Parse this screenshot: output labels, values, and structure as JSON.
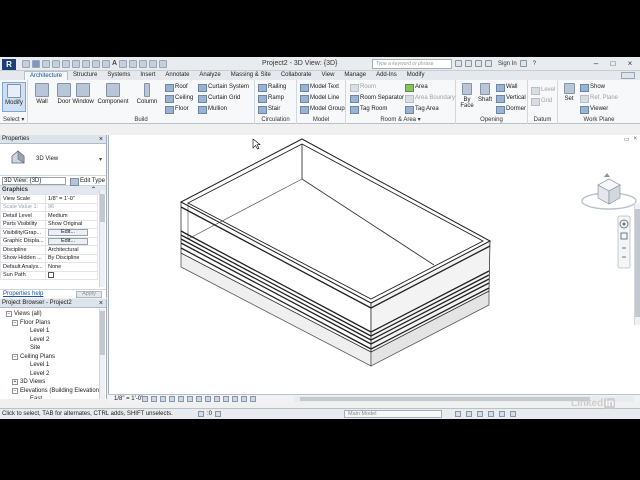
{
  "titlebar": {
    "app_logo": "R",
    "window_title": "Project2 - 3D View: {3D}",
    "search_placeholder": "Type a keyword or phrase",
    "sign_in": "Sign In",
    "help": "?"
  },
  "tabs": [
    "Architecture",
    "Structure",
    "Systems",
    "Insert",
    "Annotate",
    "Analyze",
    "Massing & Site",
    "Collaborate",
    "View",
    "Manage",
    "Add-Ins",
    "Modify"
  ],
  "ribbon": {
    "select": {
      "modify": "Modify",
      "panel": "Select ▾"
    },
    "build": {
      "wall": "Wall",
      "door": "Door",
      "window": "Window",
      "component": "Component",
      "column": "Column",
      "roof": "Roof",
      "ceiling": "Ceiling",
      "floor": "Floor",
      "curtain_system": "Curtain System",
      "curtain_grid": "Curtain Grid",
      "mullion": "Mullion",
      "panel": "Build"
    },
    "circulation": {
      "railing": "Railing",
      "ramp": "Ramp",
      "stair": "Stair",
      "panel": "Circulation"
    },
    "model": {
      "model_text": "Model Text",
      "model_line": "Model Line",
      "model_group": "Model Group",
      "panel": "Model"
    },
    "room_area": {
      "room": "Room",
      "room_separator": "Room Separator",
      "tag_room": "Tag Room",
      "area": "Area",
      "area_boundary": "Area Boundary",
      "tag_area": "Tag Area",
      "panel": "Room & Area ▾"
    },
    "opening": {
      "by_face": "By Face",
      "shaft": "Shaft",
      "wall": "Wall",
      "vertical": "Vertical",
      "dormer": "Dormer",
      "panel": "Opening"
    },
    "datum": {
      "level": "Level",
      "grid": "Grid",
      "panel": "Datum"
    },
    "work_plane": {
      "set": "Set",
      "show": "Show",
      "ref_plane": "Ref. Plane",
      "viewer": "Viewer",
      "panel": "Work Plane"
    }
  },
  "properties": {
    "title": "Properties",
    "close": "×",
    "type_name": "3D View",
    "instance_selector": "3D View: {3D}",
    "edit_type": "Edit Type",
    "category": "Graphics",
    "rows": [
      {
        "key": "View Scale",
        "value": "1/8\" = 1'-0\"",
        "dim": false
      },
      {
        "key": "Scale Value   1:",
        "value": "96",
        "dim": true
      },
      {
        "key": "Detail Level",
        "value": "Medium",
        "dim": false
      },
      {
        "key": "Parts Visibility",
        "value": "Show Original",
        "dim": false
      },
      {
        "key": "Visibility/Grap...",
        "value": "Edit...",
        "dim": false,
        "button": true
      },
      {
        "key": "Graphic Displa...",
        "value": "Edit...",
        "dim": false,
        "button": true
      },
      {
        "key": "Discipline",
        "value": "Architectural",
        "dim": false
      },
      {
        "key": "Show Hidden ...",
        "value": "By Discipline",
        "dim": false
      },
      {
        "key": "Default Analys...",
        "value": "None",
        "dim": false
      },
      {
        "key": "Sun Path",
        "value": "",
        "dim": false,
        "checkbox": true
      }
    ],
    "help_link": "Properties help",
    "apply": "Apply"
  },
  "project_browser": {
    "title": "Project Browser - Project2",
    "close": "×",
    "items": [
      {
        "label": "Views (all)",
        "toggle": "−"
      },
      {
        "label": "Floor Plans",
        "toggle": "−"
      },
      {
        "label": "Level 1",
        "toggle": ""
      },
      {
        "label": "Level 2",
        "toggle": ""
      },
      {
        "label": "Site",
        "toggle": ""
      },
      {
        "label": "Ceiling Plans",
        "toggle": "−"
      },
      {
        "label": "Level 1",
        "toggle": ""
      },
      {
        "label": "Level 2",
        "toggle": ""
      },
      {
        "label": "3D Views",
        "toggle": "+"
      },
      {
        "label": "Elevations (Building Elevation",
        "toggle": "−"
      },
      {
        "label": "East",
        "toggle": ""
      }
    ]
  },
  "view_control": {
    "scale": "1/8\" = 1'-0\""
  },
  "viewcube": {
    "face_label": "FRONT"
  },
  "status": {
    "message": "Click to select, TAB for alternates, CTRL adds, SHIFT unselects.",
    "zero": ":0",
    "main_model": "Main Model"
  },
  "watermark": {
    "text": "Linked",
    "in": "in"
  },
  "colors": {
    "active_tab": "#0b4c97",
    "link": "#1a56b0",
    "title_bar": "#e9ecef"
  }
}
